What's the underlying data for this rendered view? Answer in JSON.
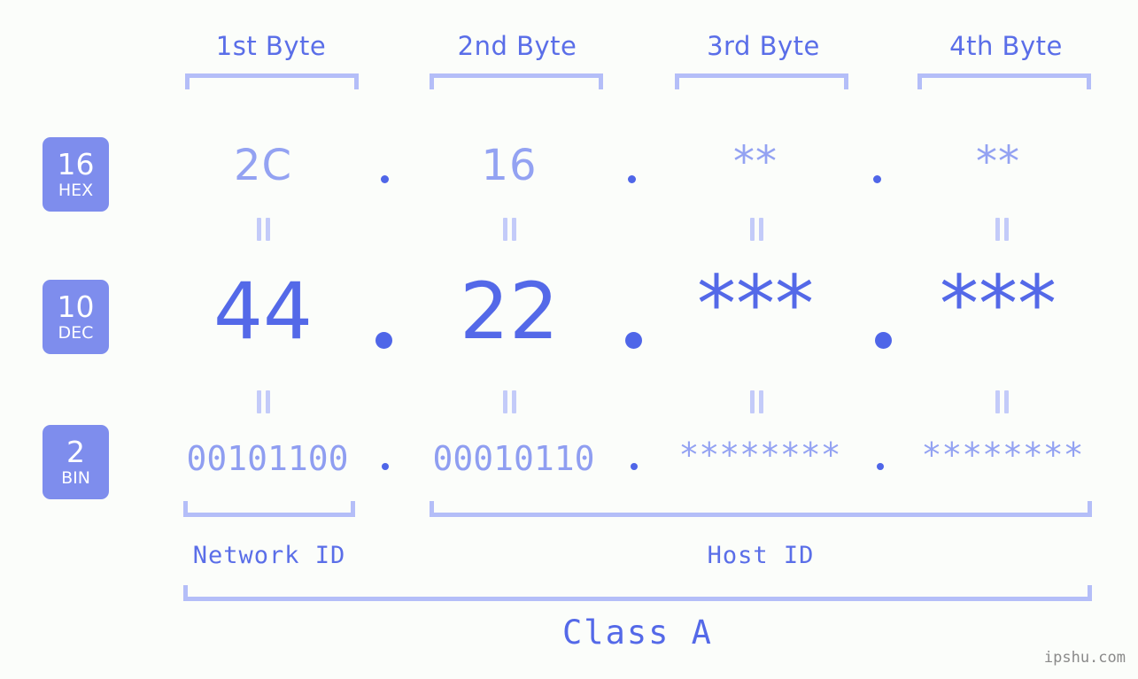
{
  "meta": {
    "watermark": "ipshu.com",
    "background_color": "#fbfdfa",
    "accent_strong": "#5469e8",
    "accent_light": "#93a2f2",
    "bracket_color": "#b4bef8",
    "badge_color": "#7e8ded"
  },
  "byte_headers": [
    {
      "label": "1st Byte"
    },
    {
      "label": "2nd Byte"
    },
    {
      "label": "3rd Byte"
    },
    {
      "label": "4th Byte"
    }
  ],
  "bases": [
    {
      "number": "16",
      "name": "HEX"
    },
    {
      "number": "10",
      "name": "DEC"
    },
    {
      "number": "2",
      "name": "BIN"
    }
  ],
  "rows": {
    "hex": {
      "values": [
        "2C",
        "16",
        "**",
        "**"
      ]
    },
    "dec": {
      "values": [
        "44",
        "22",
        "***",
        "***"
      ]
    },
    "bin": {
      "values": [
        "00101100",
        "00010110",
        "********",
        "********"
      ]
    }
  },
  "separator": ".",
  "sections": [
    {
      "label": "Network ID"
    },
    {
      "label": "Host ID"
    }
  ],
  "class": {
    "label": "Class A"
  }
}
